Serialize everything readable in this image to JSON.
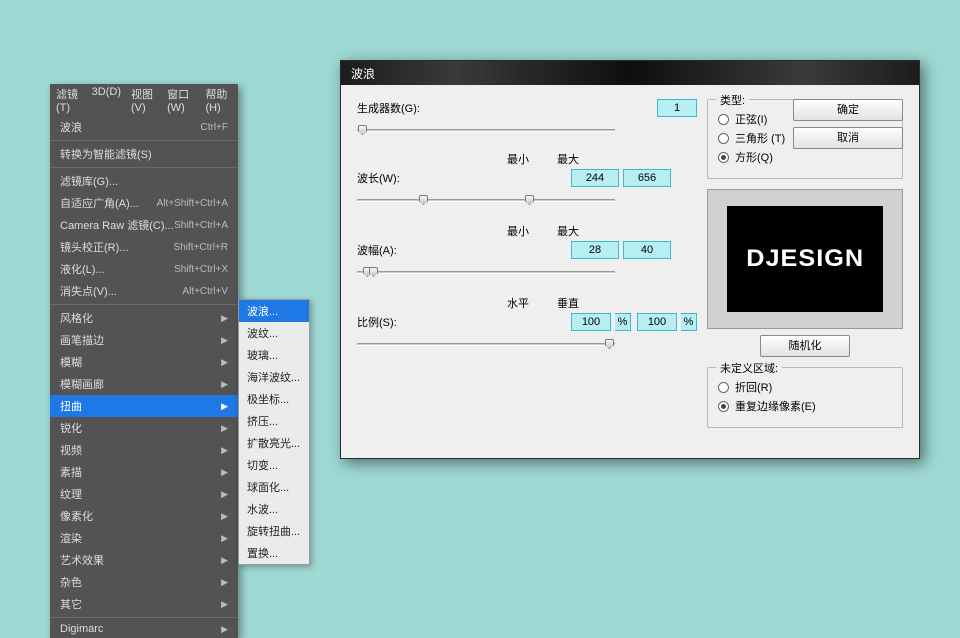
{
  "menubar": [
    "滤镜(T)",
    "3D(D)",
    "视图(V)",
    "窗口(W)",
    "帮助(H)"
  ],
  "menu": {
    "recent": {
      "label": "波浪",
      "shortcut": "Ctrl+F"
    },
    "convert": "转换为智能滤镜(S)",
    "section2": [
      {
        "label": "滤镜库(G)...",
        "shortcut": ""
      },
      {
        "label": "自适应广角(A)...",
        "shortcut": "Alt+Shift+Ctrl+A"
      },
      {
        "label": "Camera Raw 滤镜(C)...",
        "shortcut": "Shift+Ctrl+A"
      },
      {
        "label": "镜头校正(R)...",
        "shortcut": "Shift+Ctrl+R"
      },
      {
        "label": "液化(L)...",
        "shortcut": "Shift+Ctrl+X"
      },
      {
        "label": "消失点(V)...",
        "shortcut": "Alt+Ctrl+V"
      }
    ],
    "groups": [
      "风格化",
      "画笔描边",
      "模糊",
      "模糊画廊",
      "扭曲",
      "锐化",
      "视频",
      "素描",
      "纹理",
      "像素化",
      "渲染",
      "艺术效果",
      "杂色",
      "其它"
    ],
    "selected_group_index": 4,
    "last": "Digimarc"
  },
  "submenu": [
    "波浪...",
    "波纹...",
    "玻璃...",
    "海洋波纹...",
    "极坐标...",
    "挤压...",
    "扩散亮光...",
    "切变...",
    "球面化...",
    "水波...",
    "旋转扭曲...",
    "置换..."
  ],
  "submenu_selected_index": 0,
  "dialog": {
    "title": "波浪",
    "generators_label": "生成器数(G):",
    "generators_value": "1",
    "wavelength_label": "波长(W):",
    "min_label": "最小",
    "max_label": "最大",
    "wavelength_min": "244",
    "wavelength_max": "656",
    "amplitude_label": "波幅(A):",
    "amplitude_min": "28",
    "amplitude_max": "40",
    "scale_label": "比例(S):",
    "horiz_label": "水平",
    "vert_label": "垂直",
    "scale_h": "100",
    "scale_v": "100",
    "pct": "%",
    "type_title": "类型:",
    "type_opts": [
      "正弦(I)",
      "三角形 (T)",
      "方形(Q)"
    ],
    "type_selected_index": 2,
    "ok": "确定",
    "cancel": "取消",
    "randomize": "随机化",
    "undef_title": "未定义区域:",
    "undef_opts": [
      "折回(R)",
      "重复边缘像素(E)"
    ],
    "undef_selected_index": 1,
    "preview_text": "DJESIGN"
  }
}
